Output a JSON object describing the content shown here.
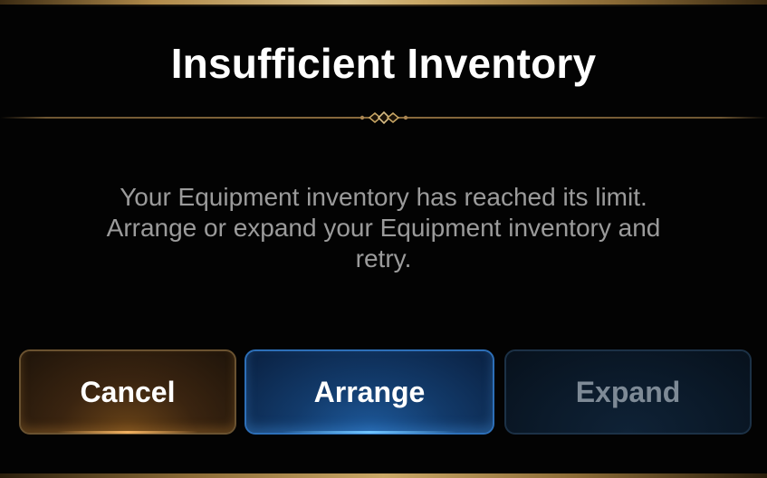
{
  "dialog": {
    "title": "Insufficient Inventory",
    "message_lines": [
      "Your Equipment inventory has reached its limit.",
      "Arrange or expand your Equipment inventory and",
      "retry."
    ]
  },
  "buttons": {
    "cancel_label": "Cancel",
    "arrange_label": "Arrange",
    "expand_label": "Expand"
  },
  "colors": {
    "background": "#030303",
    "gold_accent": "#c9a765",
    "title_text": "#ffffff",
    "message_text": "#9b9b9b",
    "cancel_border": "#6a5230",
    "arrange_border": "#2d6fb8",
    "expand_text_disabled": "#7e8a96"
  },
  "icons": {
    "divider_ornament": "diamond-ornament-icon"
  }
}
